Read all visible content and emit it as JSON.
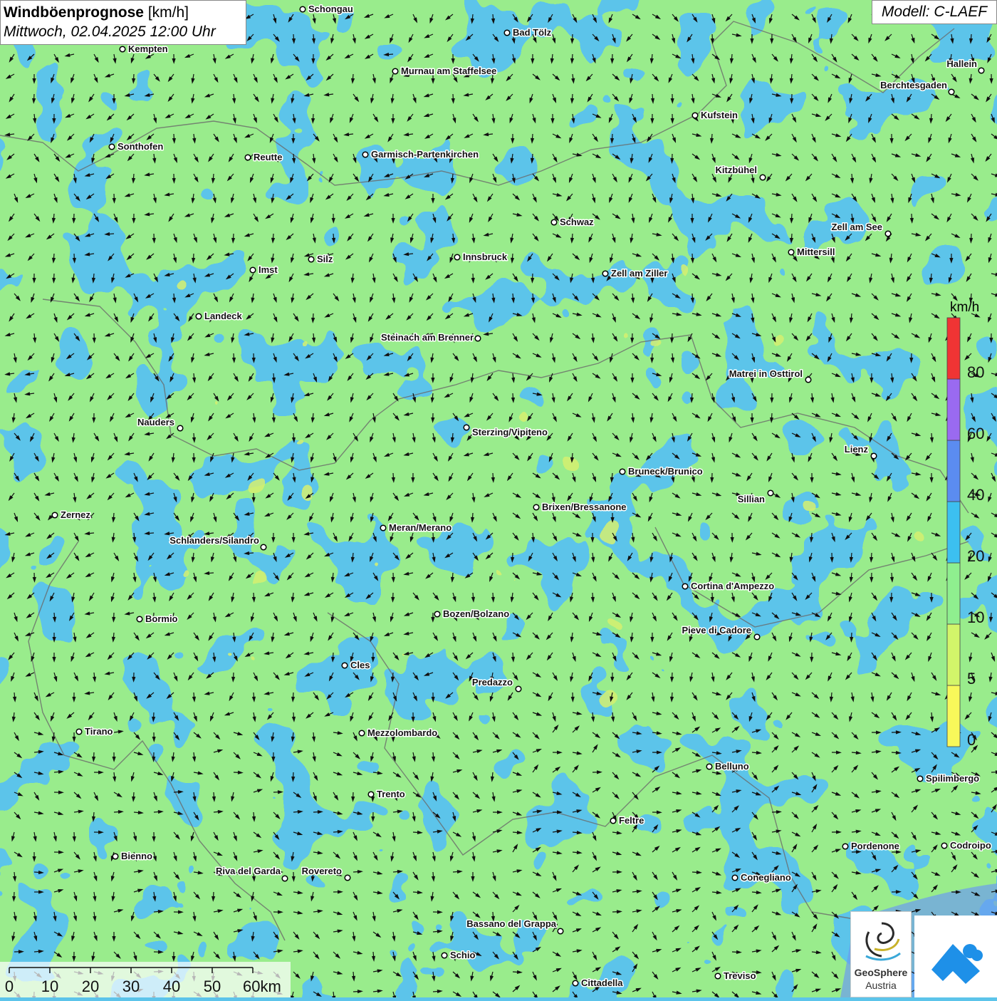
{
  "title": {
    "main": "Windböenprognose",
    "unit": "[km/h]",
    "datetime": "Mittwoch, 02.04.2025 12:00 Uhr"
  },
  "model_label": "Modell: C-LAEF",
  "legend": {
    "unit": "km/h",
    "ticks": [
      "0",
      "5",
      "10",
      "20",
      "40",
      "60",
      "80"
    ],
    "colors": [
      "#f8f85a",
      "#d2f56a",
      "#8fef8f",
      "#3cc0f0",
      "#5b8cf0",
      "#9a6af0",
      "#f03434"
    ]
  },
  "scale_bar": {
    "labels": [
      "0",
      "10",
      "20",
      "30",
      "40",
      "50",
      "60km"
    ]
  },
  "cities": [
    {
      "name": "Schongau"
    },
    {
      "name": "Bad Tölz"
    },
    {
      "name": "Kempten"
    },
    {
      "name": "Murnau am Staffelsee"
    },
    {
      "name": "Hallein"
    },
    {
      "name": "Berchtesgaden"
    },
    {
      "name": "Kufstein"
    },
    {
      "name": "Sonthofen"
    },
    {
      "name": "Reutte"
    },
    {
      "name": "Garmisch-Partenkirchen"
    },
    {
      "name": "Kitzbühel"
    },
    {
      "name": "Schwaz"
    },
    {
      "name": "Zell am See"
    },
    {
      "name": "Mittersill"
    },
    {
      "name": "Silz"
    },
    {
      "name": "Innsbruck"
    },
    {
      "name": "Imst"
    },
    {
      "name": "Zell am Ziller"
    },
    {
      "name": "Landeck"
    },
    {
      "name": "Steinach am Brenner"
    },
    {
      "name": "Matrei in Osttirol"
    },
    {
      "name": "Nauders"
    },
    {
      "name": "Sterzing/Vipiteno"
    },
    {
      "name": "Lienz"
    },
    {
      "name": "Bruneck/Brunico"
    },
    {
      "name": "Sillian"
    },
    {
      "name": "Brixen/Bressanone"
    },
    {
      "name": "Zernez"
    },
    {
      "name": "Meran/Merano"
    },
    {
      "name": "Schlanders/Silandro"
    },
    {
      "name": "Cortina d'Ampezzo"
    },
    {
      "name": "Bozen/Bolzano"
    },
    {
      "name": "Bormio"
    },
    {
      "name": "Pieve di Cadore"
    },
    {
      "name": "Cles"
    },
    {
      "name": "Predazzo"
    },
    {
      "name": "Tirano"
    },
    {
      "name": "Mezzolombardo"
    },
    {
      "name": "Belluno"
    },
    {
      "name": "Spilimbergo"
    },
    {
      "name": "Trento"
    },
    {
      "name": "Feltre"
    },
    {
      "name": "Pordenone"
    },
    {
      "name": "Codroipo"
    },
    {
      "name": "Bienno"
    },
    {
      "name": "Riva del Garda"
    },
    {
      "name": "Rovereto"
    },
    {
      "name": "Conegliano"
    },
    {
      "name": "Bassano del Grappa"
    },
    {
      "name": "Schio"
    },
    {
      "name": "Treviso"
    },
    {
      "name": "Cittadella"
    }
  ],
  "logo": {
    "line1": "GeoSphere",
    "line2": "Austria"
  }
}
